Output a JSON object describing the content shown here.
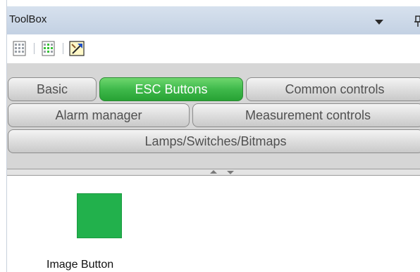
{
  "window": {
    "title": "ToolBox"
  },
  "toolbar": {
    "buttons": [
      {
        "icon": "grid-view-icon"
      },
      {
        "icon": "grid-highlight-icon"
      },
      {
        "icon": "build-tool-icon"
      }
    ]
  },
  "tabs": {
    "row1": [
      {
        "label": "Basic",
        "active": false
      },
      {
        "label": "ESC Buttons",
        "active": true
      },
      {
        "label": "Common controls",
        "active": false
      }
    ],
    "row2": [
      {
        "label": "Alarm manager",
        "active": false
      },
      {
        "label": "Measurement controls",
        "active": false
      }
    ],
    "row3": [
      {
        "label": "Lamps/Switches/Bitmaps",
        "active": false
      }
    ]
  },
  "content": {
    "items": [
      {
        "label": "Image Button",
        "icon": "image-button-icon",
        "color": "#22b14c"
      }
    ]
  },
  "colors": {
    "active_tab": "#3fb94b",
    "title_bar": "#c9d6e8",
    "tab_area": "#d6d6d6"
  }
}
